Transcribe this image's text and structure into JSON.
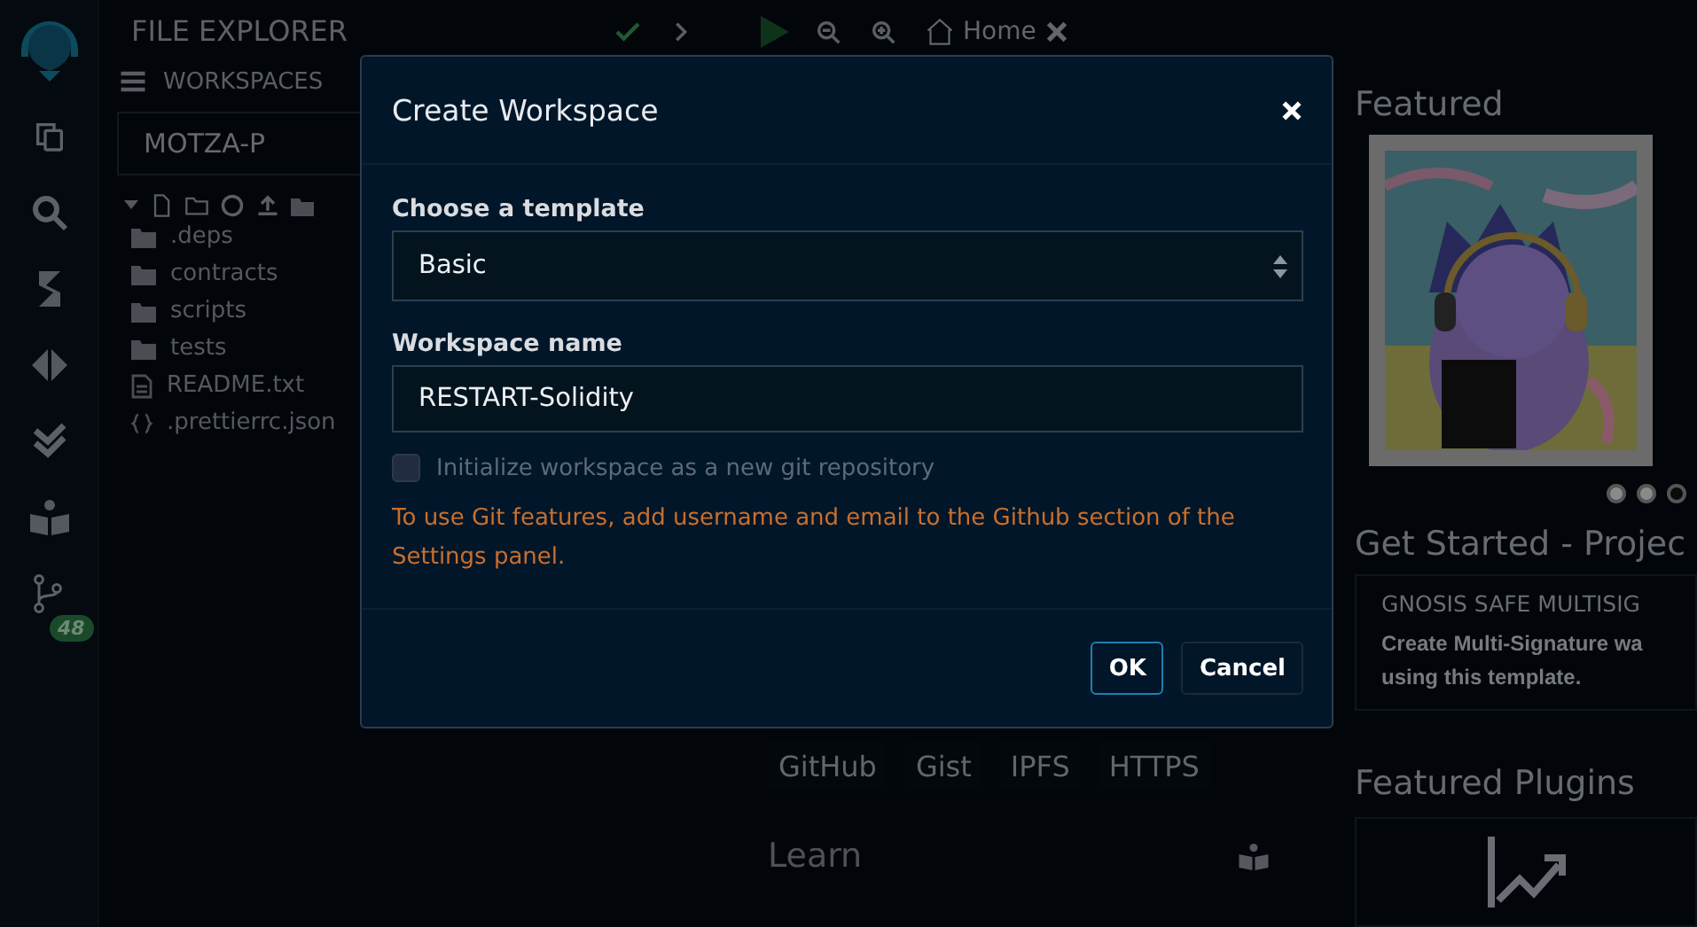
{
  "sidebar": {
    "badge": "48"
  },
  "explorer": {
    "title": "FILE EXPLORER",
    "workspaces_label": "WORKSPACES",
    "workspace": "MOTZA-P",
    "files": [
      {
        "name": ".deps",
        "kind": "folder"
      },
      {
        "name": "contracts",
        "kind": "folder"
      },
      {
        "name": "scripts",
        "kind": "folder"
      },
      {
        "name": "tests",
        "kind": "folder"
      },
      {
        "name": "README.txt",
        "kind": "file"
      },
      {
        "name": ".prettierrc.json",
        "kind": "json"
      }
    ]
  },
  "toolbar": {
    "tab": "Home"
  },
  "home": {
    "import_sources": [
      "GitHub",
      "Gist",
      "IPFS",
      "HTTPS"
    ],
    "learn_title": "Learn"
  },
  "right": {
    "featured_title": "Featured",
    "featured_image": {
      "kind": "picture"
    },
    "carousel": [
      {
        "selected": false
      },
      {
        "selected": false
      },
      {
        "selected": true
      }
    ],
    "get_started_title": "Get Started  - Projec",
    "card_title": "GNOSIS SAFE MULTISIG",
    "card_lines": [
      "Create Multi-Signature wa",
      "using this template."
    ],
    "plugins_title": "Featured Plugins"
  },
  "modal": {
    "title": "Create Workspace",
    "template_label": "Choose a template",
    "template_value": "Basic",
    "name_label": "Workspace name",
    "name_value": "RESTART-Solidity",
    "git_checkbox": {
      "label": "Initialize workspace as a new git repository",
      "checked": false,
      "disabled": true
    },
    "warning": "To use Git features, add username and email to the Github section of the Settings panel.",
    "buttons": [
      {
        "label": "OK",
        "kind": "primary"
      },
      {
        "label": "Cancel",
        "kind": "secondary"
      }
    ]
  }
}
